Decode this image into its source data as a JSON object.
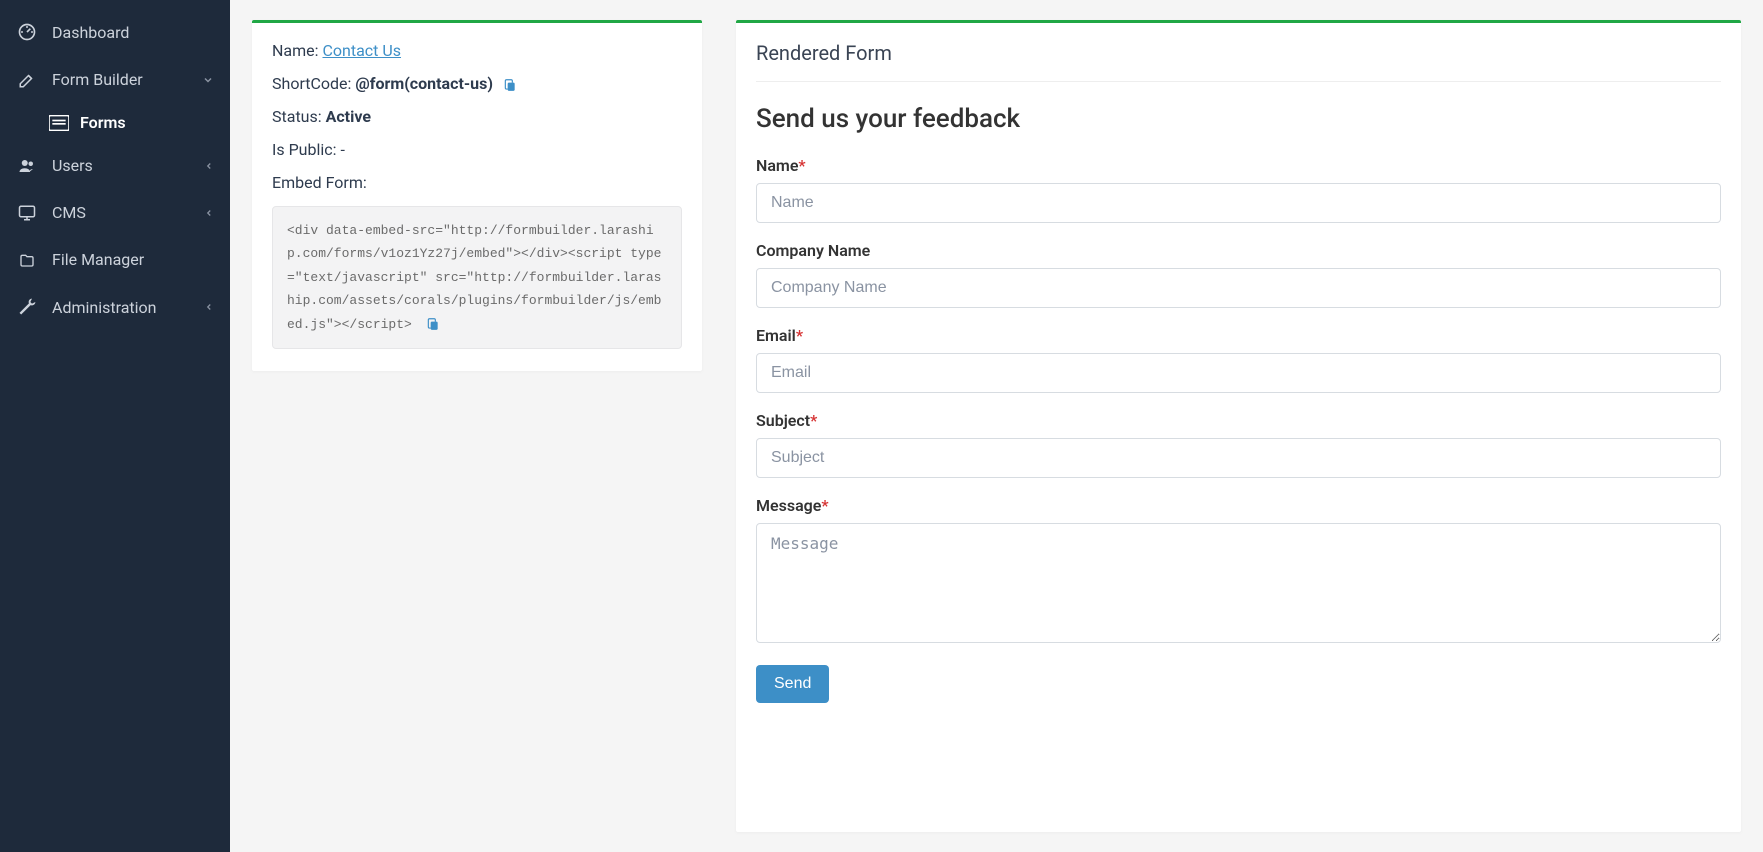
{
  "sidebar": {
    "dashboard": "Dashboard",
    "formbuilder": "Form Builder",
    "forms": "Forms",
    "users": "Users",
    "cms": "CMS",
    "filemanager": "File Manager",
    "administration": "Administration"
  },
  "details": {
    "name_label": "Name: ",
    "name_value": "Contact Us",
    "shortcode_label": "ShortCode: ",
    "shortcode_value": "@form(contact-us)",
    "status_label": "Status: ",
    "status_value": "Active",
    "public_label": "Is Public: ",
    "public_value": "-",
    "embed_label": "Embed Form:",
    "embed_code": "<div data-embed-src=\"http://formbuilder.laraship.com/forms/v1oz1Yz27j/embed\"></div><script type=\"text/javascript\" src=\"http://formbuilder.laraship.com/assets/corals/plugins/formbuilder/js/embed.js\"></script>"
  },
  "rendered": {
    "panel_title": "Rendered Form",
    "form_title": "Send us your feedback",
    "name_label": "Name",
    "name_placeholder": "Name",
    "company_label": "Company Name",
    "company_placeholder": "Company Name",
    "email_label": "Email",
    "email_placeholder": "Email",
    "subject_label": "Subject",
    "subject_placeholder": "Subject",
    "message_label": "Message",
    "message_placeholder": "Message",
    "send_label": "Send"
  }
}
